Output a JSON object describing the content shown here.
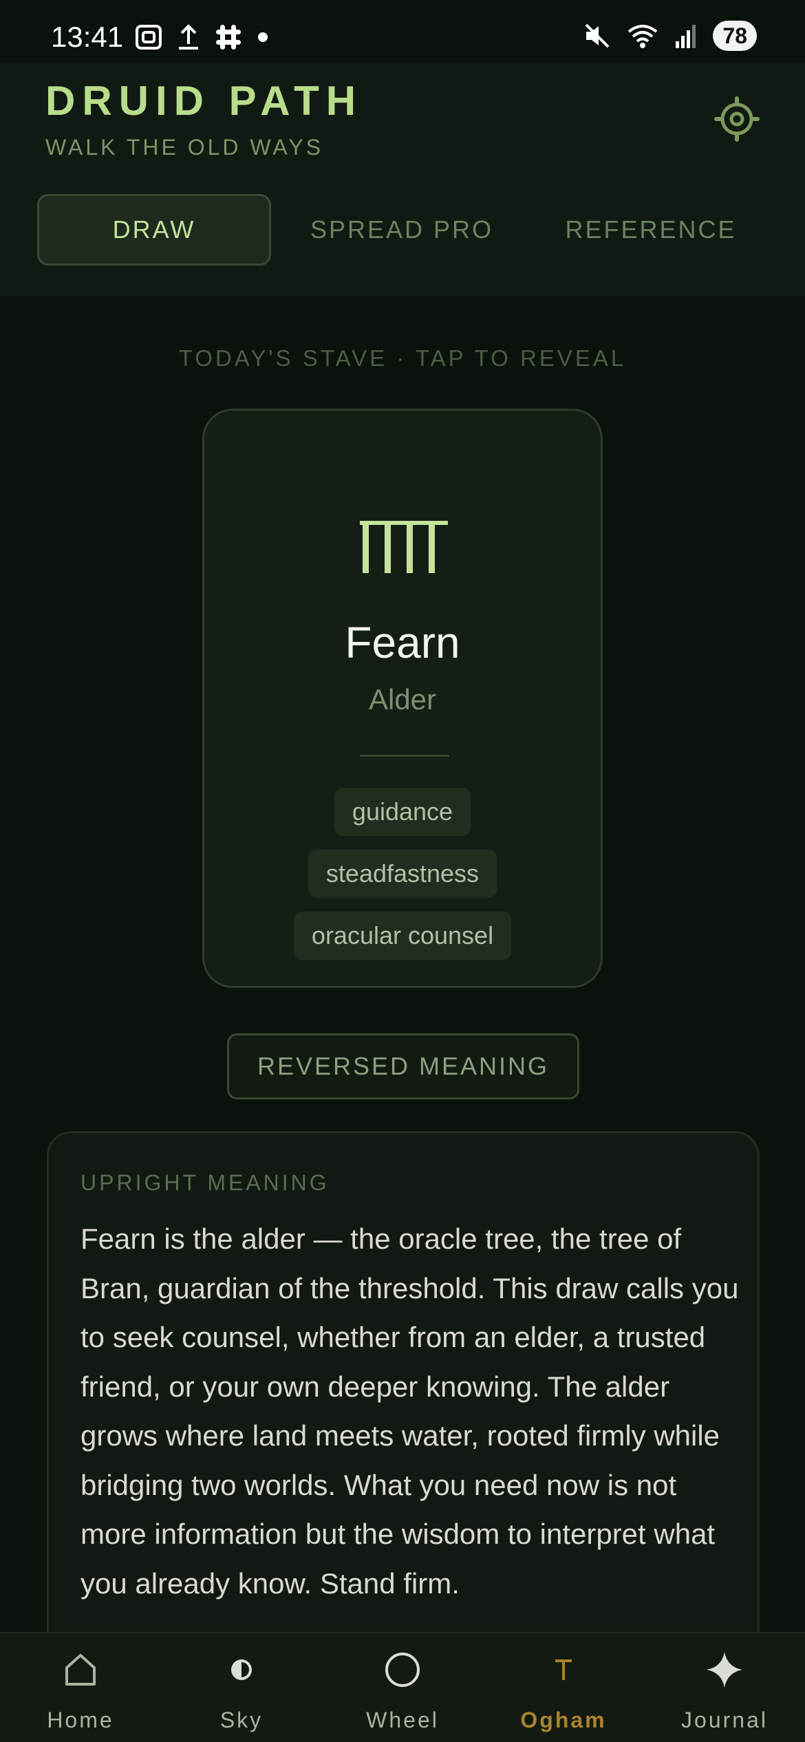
{
  "status_bar": {
    "time": "13:41",
    "battery": "78"
  },
  "header": {
    "title": "DRUID PATH",
    "subtitle": "WALK THE OLD WAYS"
  },
  "tabs": [
    {
      "label": "DRAW",
      "active": true
    },
    {
      "label": "SPREAD  PRO",
      "active": false
    },
    {
      "label": "REFERENCE",
      "active": false
    }
  ],
  "draw": {
    "today_label": "TODAY'S STAVE · TAP TO REVEAL",
    "stave": {
      "name": "Fearn",
      "tree": "Alder",
      "keywords": [
        "guidance",
        "steadfastness",
        "oracular counsel"
      ]
    },
    "reversed_button": "REVERSED MEANING",
    "upright": {
      "label": "UPRIGHT MEANING",
      "text": "Fearn is the alder — the oracle tree, the tree of Bran, guardian of the threshold. This draw calls you to seek counsel, whether from an elder, a trusted friend, or your own deeper knowing. The alder grows where land meets water, rooted firmly while bridging two worlds. What you need now is not more information but the wisdom to interpret what you already know. Stand firm."
    }
  },
  "nav": [
    {
      "label": "Home",
      "icon": "home-icon"
    },
    {
      "label": "Sky",
      "icon": "moon-phase-icon"
    },
    {
      "label": "Wheel",
      "icon": "circle-icon"
    },
    {
      "label": "Ogham",
      "icon": "ogham-icon",
      "active": true
    },
    {
      "label": "Journal",
      "icon": "sparkle-icon"
    }
  ],
  "colors": {
    "accent": "#b9dc8c",
    "active_nav": "#a9822a",
    "background": "#0b110b"
  }
}
